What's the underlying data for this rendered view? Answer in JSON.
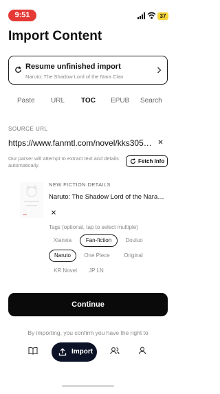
{
  "status_bar": {
    "time": "9:51",
    "battery": "37"
  },
  "page": {
    "title": "Import Content"
  },
  "resume": {
    "title": "Resume unfinished import",
    "subtitle": "Naruto: The Shadow Lord of the Nara Clan"
  },
  "tabs": [
    {
      "label": "Paste",
      "active": false
    },
    {
      "label": "URL",
      "active": false
    },
    {
      "label": "TOC",
      "active": true
    },
    {
      "label": "EPUB",
      "active": false
    },
    {
      "label": "Search",
      "active": false
    }
  ],
  "source": {
    "section_label": "SOURCE URL",
    "url_value": "https://www.fanmtl.com/novel/kks30576...",
    "clear_icon": "close-icon",
    "helper": "Our parser will attempt to extract text and details automatically.",
    "fetch_label": "Fetch Info"
  },
  "new_fiction": {
    "label": "NEW FICTION DETAILS",
    "title": "Naruto: The Shadow Lord of the Nara C...",
    "remove_icon": "close-icon"
  },
  "tags": {
    "label": "Tags (optional, tap to select multiple)",
    "items": [
      {
        "label": "Xianxia",
        "selected": false
      },
      {
        "label": "Fan-fiction",
        "selected": true
      },
      {
        "label": "Douluo",
        "selected": false
      },
      {
        "label": "Naruto",
        "selected": true
      },
      {
        "label": "One Piece",
        "selected": false
      },
      {
        "label": "Original",
        "selected": false
      },
      {
        "label": "KR Novel",
        "selected": false
      },
      {
        "label": "JP LN",
        "selected": false
      }
    ]
  },
  "actions": {
    "continue_label": "Continue"
  },
  "disclaimer": "By importing, you confirm you have the right to",
  "bottom_nav": {
    "items": [
      {
        "icon": "book-icon"
      },
      {
        "label": "Import",
        "icon": "upload-icon",
        "active": true
      },
      {
        "icon": "users-icon"
      },
      {
        "icon": "user-icon"
      }
    ]
  },
  "colors": {
    "accent": "#0a0a0a",
    "nav_pill": "#0d1326",
    "time_pill": "#e53935",
    "battery": "#f4d63b"
  }
}
